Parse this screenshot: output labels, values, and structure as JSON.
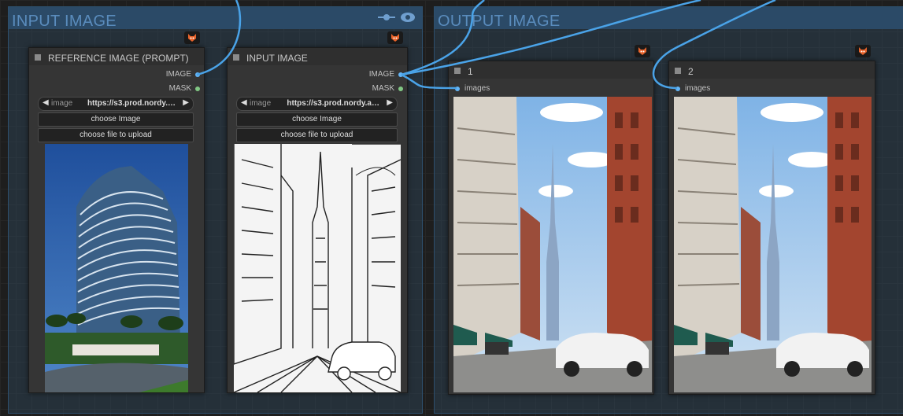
{
  "groups": {
    "input": {
      "title": "INPUT IMAGE"
    },
    "output": {
      "title": "OUTPUT IMAGE"
    }
  },
  "icons": {
    "fox_badge": "fox-icon",
    "connect": "link-icon",
    "visibility": "eye-icon",
    "prev": "◀",
    "next": "▶"
  },
  "nodes": {
    "reference": {
      "title": "REFERENCE IMAGE (PROMPT)",
      "outputs": [
        "IMAGE",
        "MASK"
      ],
      "widget": {
        "label": "image",
        "value": "https://s3.prod.nordy.…"
      },
      "buttons": [
        "choose Image",
        "choose file to upload"
      ]
    },
    "input": {
      "title": "INPUT IMAGE",
      "outputs": [
        "IMAGE",
        "MASK"
      ],
      "widget": {
        "label": "image",
        "value": "https://s3.prod.nordy.a…"
      },
      "buttons": [
        "choose Image",
        "choose file to upload"
      ]
    },
    "output1": {
      "title": "1",
      "input": "images"
    },
    "output2": {
      "title": "2",
      "input": "images"
    }
  },
  "colors": {
    "link": "#4aa3e8",
    "image_port": "#64b5f6",
    "mask_port": "#81c784",
    "group_title": "#5a8cbd"
  }
}
